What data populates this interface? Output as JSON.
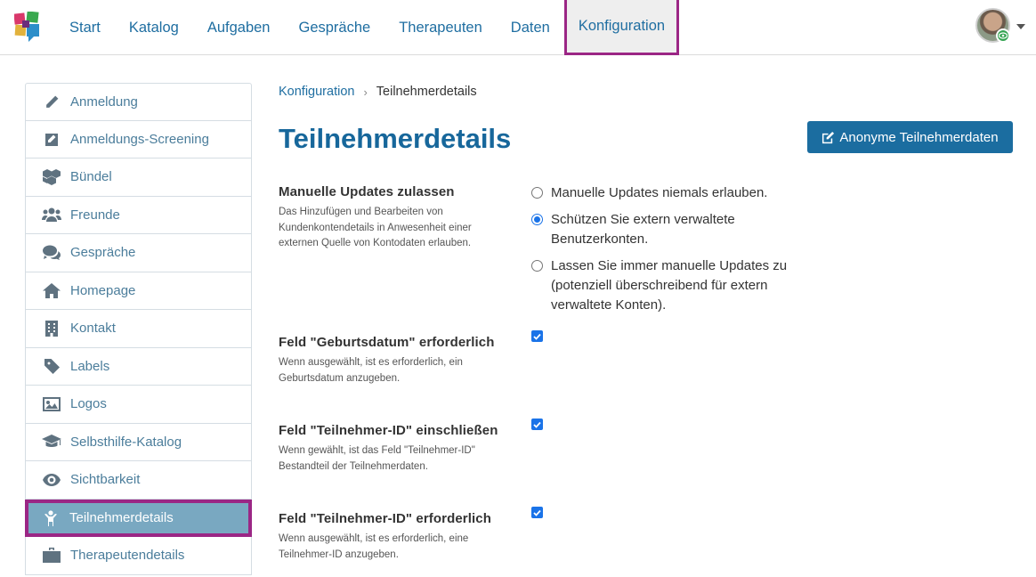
{
  "nav": {
    "items": [
      "Start",
      "Katalog",
      "Aufgaben",
      "Gespräche",
      "Therapeuten",
      "Daten",
      "Konfiguration"
    ],
    "active": "Konfiguration"
  },
  "sidebar": {
    "items": [
      {
        "label": "Anmeldung",
        "icon": "pencil-icon"
      },
      {
        "label": "Anmeldungs-Screening",
        "icon": "edit-square-icon"
      },
      {
        "label": "Bündel",
        "icon": "cubes-icon"
      },
      {
        "label": "Freunde",
        "icon": "users-icon"
      },
      {
        "label": "Gespräche",
        "icon": "comments-icon"
      },
      {
        "label": "Homepage",
        "icon": "home-icon"
      },
      {
        "label": "Kontakt",
        "icon": "building-icon"
      },
      {
        "label": "Labels",
        "icon": "tag-icon"
      },
      {
        "label": "Logos",
        "icon": "image-icon"
      },
      {
        "label": "Selbsthilfe-Katalog",
        "icon": "graduation-cap-icon"
      },
      {
        "label": "Sichtbarkeit",
        "icon": "eye-icon"
      },
      {
        "label": "Teilnehmerdetails",
        "icon": "person-icon"
      },
      {
        "label": "Therapeutendetails",
        "icon": "briefcase-icon"
      }
    ],
    "active": "Teilnehmerdetails"
  },
  "breadcrumb": {
    "parent": "Konfiguration",
    "separator": "›",
    "current": "Teilnehmerdetails"
  },
  "page": {
    "title": "Teilnehmerdetails",
    "anon_button": "Anonyme Teilnehmerdaten"
  },
  "settings": {
    "manual_updates": {
      "title": "Manuelle Updates zulassen",
      "description": "Das Hinzufügen und Bearbeiten von Kundenkontendetails in Anwesenheit einer externen Quelle von Kontodaten erlauben.",
      "options": [
        {
          "label": "Manuelle Updates niemals erlauben.",
          "checked": false
        },
        {
          "label": "Schützen Sie extern verwaltete Benutzerkonten.",
          "checked": true
        },
        {
          "label": "Lassen Sie immer manuelle Updates zu (potenziell überschreibend für extern verwaltete Konten).",
          "checked": false
        }
      ]
    },
    "birthdate_required": {
      "title": "Feld \"Geburtsdatum\" erforderlich",
      "description": "Wenn ausgewählt, ist es erforderlich, ein Geburtsdatum anzugeben.",
      "checked": true
    },
    "participant_id_include": {
      "title": "Feld \"Teilnehmer-ID\" einschließen",
      "description": "Wenn gewählt, ist das Feld \"Teilnehmer-ID\" Bestandteil der Teilnehmerdaten.",
      "checked": true
    },
    "participant_id_required": {
      "title": "Feld \"Teilnehmer-ID\" erforderlich",
      "description": "Wenn ausgewählt, ist es erforderlich, eine Teilnehmer-ID anzugeben.",
      "checked": true
    }
  },
  "colors": {
    "primary": "#1b6da0",
    "highlight": "#9b2685",
    "sidebar_active": "#79a8c1"
  }
}
